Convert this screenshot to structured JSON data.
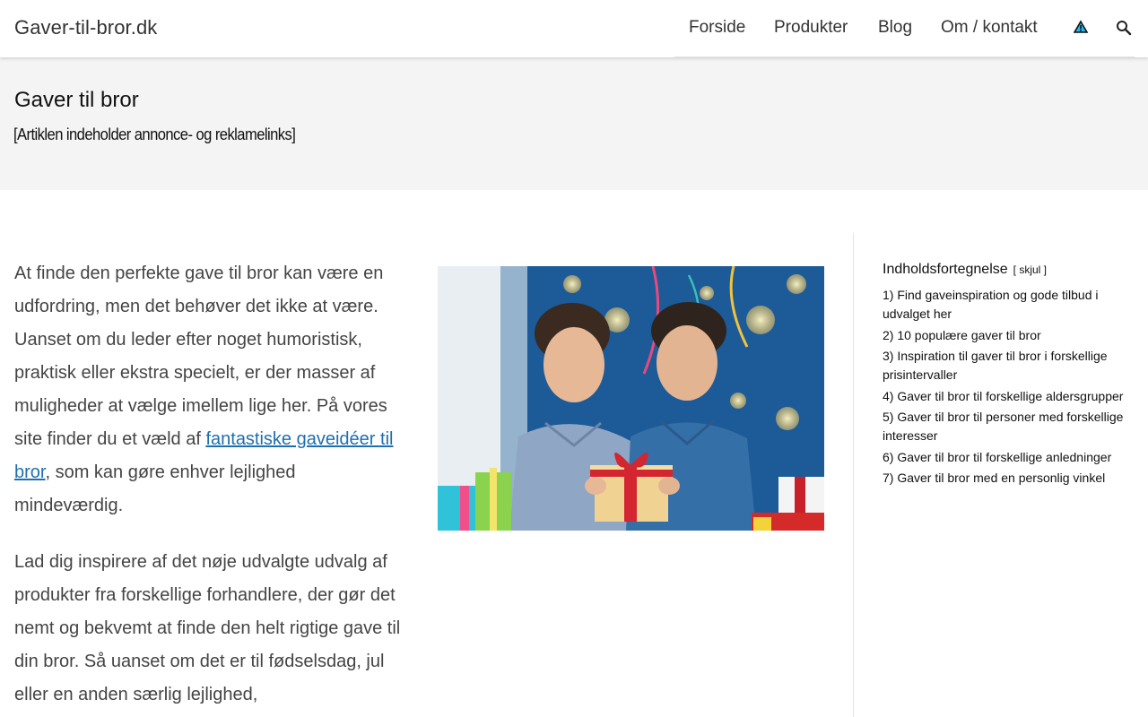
{
  "header": {
    "site_title": "Gaver-til-bror.dk",
    "nav": [
      "Forside",
      "Produkter",
      "Blog",
      "Om / kontakt"
    ],
    "icons": [
      "warning-triangle-icon",
      "search-icon"
    ]
  },
  "page": {
    "title": "Gaver til bror",
    "disclaimer": "[Artiklen indeholder annonce- og reklamelinks]"
  },
  "content": {
    "p1_before": "At finde den perfekte gave til bror kan være en udfordring, men det behøver det ikke at være. Uanset om du leder efter noget humoristisk, praktisk eller ekstra specielt, er der masser af muligheder at vælge imellem lige her. På vores site finder du et væld af ",
    "p1_link": "fantastiske gaveidéer til bror",
    "p1_after": ", som kan gøre enhver lejlighed mindeværdig.",
    "p2": "Lad dig inspirere af det nøje udvalgte udvalg af produkter fra forskellige forhandlere, der gør det nemt og bekvemt at finde den helt rigtige gave til din bror. Så uanset om det er til fødselsdag, jul eller en anden særlig lejlighed,"
  },
  "toc": {
    "title": "Indholdsfortegnelse",
    "toggle": "[ skjul ]",
    "items": [
      "1) Find gaveinspiration og gode tilbud i udvalget her",
      "2) 10 populære gaver til bror",
      "3) Inspiration til gaver til bror i forskellige prisintervaller",
      "4) Gaver til bror til forskellige aldersgrupper",
      "5) Gaver til bror til personer med forskellige interesser",
      "6) Gaver til bror til forskellige anledninger",
      "7) Gaver til bror med en personlig vinkel"
    ]
  },
  "colors": {
    "link": "#1e6fb0",
    "title_band": "#f4f4f4"
  }
}
